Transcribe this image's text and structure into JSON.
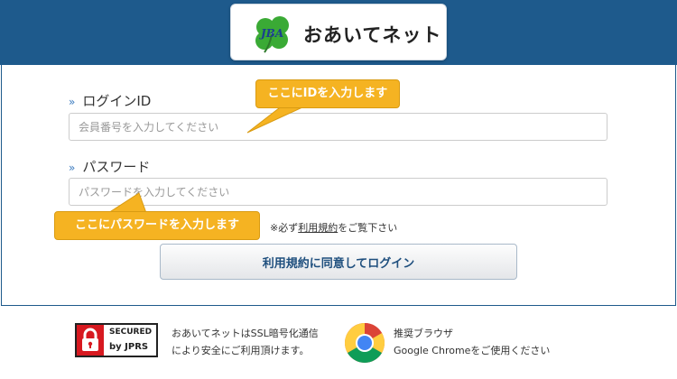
{
  "header": {
    "logo_mark": "JBA",
    "site_name": "おあいてネット"
  },
  "form": {
    "id_label": "ログインID",
    "id_placeholder": "会員番号を入力してください",
    "id_callout": "ここにIDを入力します",
    "password_label": "パスワード",
    "password_placeholder": "パスワードを入力してください",
    "password_callout": "ここにパスワードを入力します",
    "notice_prefix": "※必ず",
    "notice_link": "利用規約",
    "notice_suffix": "をご覧下さい",
    "login_button": "利用規約に同意してログイン"
  },
  "footer": {
    "seal_line1": "SECURED",
    "seal_line2": "by JPRS",
    "ssl_line1": "おあいてネットはSSL暗号化通信",
    "ssl_line2": "により安全にご利用頂けます。",
    "browser_line1": "推奨ブラウザ",
    "browser_line2": "Google Chromeをご使用ください"
  },
  "colors": {
    "header_blue": "#1e5a8c",
    "callout_orange": "#f5b322",
    "seal_red": "#d71920",
    "button_text": "#1f4f7e"
  }
}
